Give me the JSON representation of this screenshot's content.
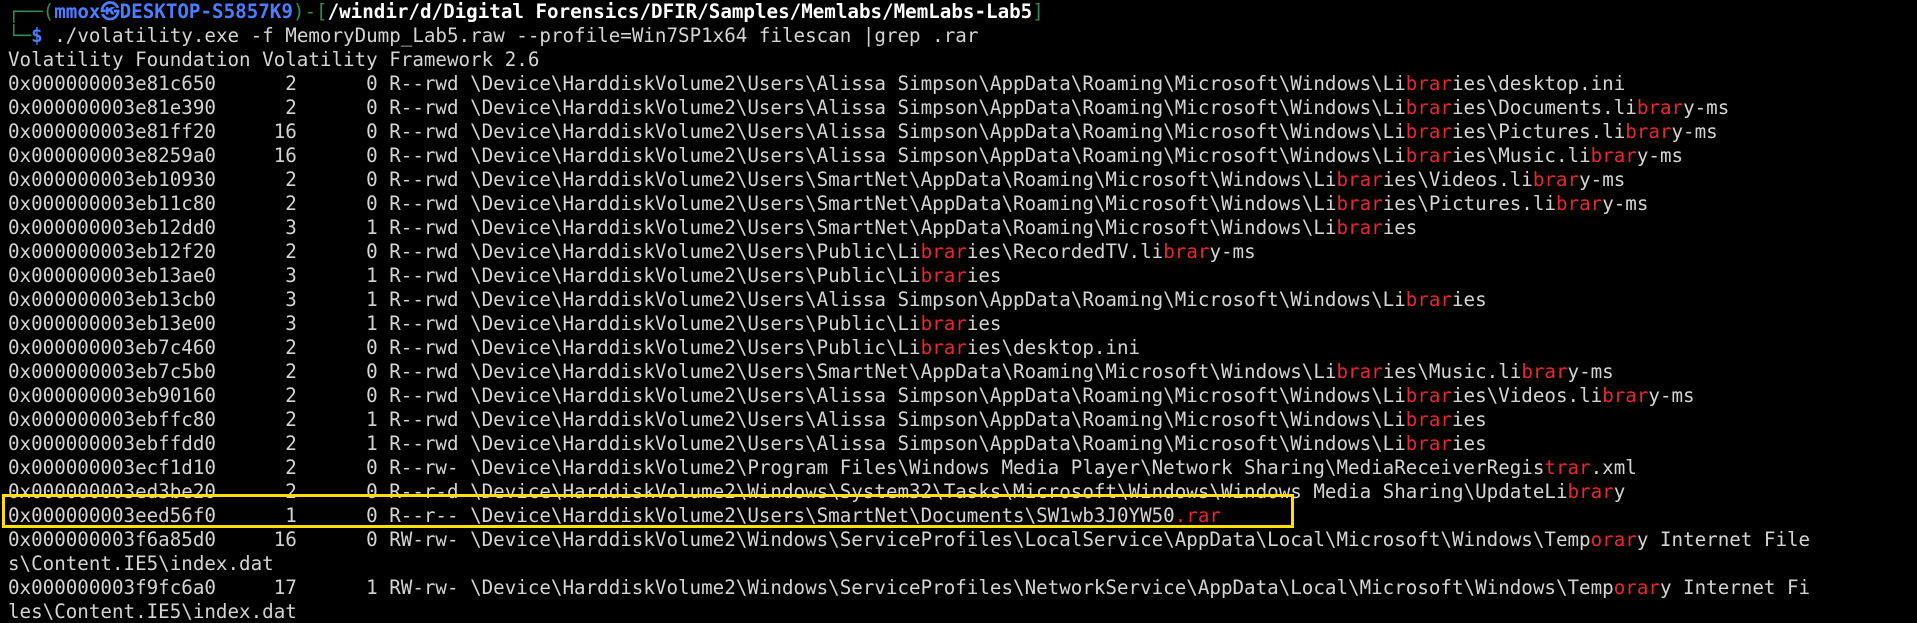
{
  "prompt": {
    "top_left": "┌──(",
    "user": "mmox",
    "at": "㉿",
    "host": "DESKTOP-S5857K9",
    "sep": ")-[",
    "path": "/windir/d/Digital Forensics/DFIR/Samples/Memlabs/MemLabs-Lab5",
    "close": "]",
    "bottom_left": "└─",
    "dollar": "$",
    "command": " ./volatility.exe -f MemoryDump_Lab5.raw --profile=Win7SP1x64 filescan |grep .rar"
  },
  "banner": "Volatility Foundation Volatility Framework 2.6",
  "colors": {
    "match": "#e8262f",
    "highlight_border": "#ffe000",
    "prompt_accent": "#4a7dff",
    "background": "#000000"
  },
  "lines": [
    {
      "pre": "0x000000003e81c650      2      0 R--rwd \\Device\\HarddiskVolume2\\Users\\Alissa Simpson\\AppData\\Roaming\\Microsoft\\Windows\\Li",
      "m1": "brar",
      "mid": "ies\\desktop.ini",
      "m2": "",
      "post": ""
    },
    {
      "pre": "0x000000003e81e390      2      0 R--rwd \\Device\\HarddiskVolume2\\Users\\Alissa Simpson\\AppData\\Roaming\\Microsoft\\Windows\\Li",
      "m1": "brar",
      "mid": "ies\\Documents.li",
      "m2": "brar",
      "post": "y-ms"
    },
    {
      "pre": "0x000000003e81ff20     16      0 R--rwd \\Device\\HarddiskVolume2\\Users\\Alissa Simpson\\AppData\\Roaming\\Microsoft\\Windows\\Li",
      "m1": "brar",
      "mid": "ies\\Pictures.li",
      "m2": "brar",
      "post": "y-ms"
    },
    {
      "pre": "0x000000003e8259a0     16      0 R--rwd \\Device\\HarddiskVolume2\\Users\\Alissa Simpson\\AppData\\Roaming\\Microsoft\\Windows\\Li",
      "m1": "brar",
      "mid": "ies\\Music.li",
      "m2": "brar",
      "post": "y-ms"
    },
    {
      "pre": "0x000000003eb10930      2      0 R--rwd \\Device\\HarddiskVolume2\\Users\\SmartNet\\AppData\\Roaming\\Microsoft\\Windows\\Li",
      "m1": "brar",
      "mid": "ies\\Videos.li",
      "m2": "brar",
      "post": "y-ms"
    },
    {
      "pre": "0x000000003eb11c80      2      0 R--rwd \\Device\\HarddiskVolume2\\Users\\SmartNet\\AppData\\Roaming\\Microsoft\\Windows\\Li",
      "m1": "brar",
      "mid": "ies\\Pictures.li",
      "m2": "brar",
      "post": "y-ms"
    },
    {
      "pre": "0x000000003eb12dd0      3      1 R--rwd \\Device\\HarddiskVolume2\\Users\\SmartNet\\AppData\\Roaming\\Microsoft\\Windows\\Li",
      "m1": "brar",
      "mid": "ies",
      "m2": "",
      "post": ""
    },
    {
      "pre": "0x000000003eb12f20      2      0 R--rwd \\Device\\HarddiskVolume2\\Users\\Public\\Li",
      "m1": "brar",
      "mid": "ies\\RecordedTV.li",
      "m2": "brar",
      "post": "y-ms"
    },
    {
      "pre": "0x000000003eb13ae0      3      1 R--rwd \\Device\\HarddiskVolume2\\Users\\Public\\Li",
      "m1": "brar",
      "mid": "ies",
      "m2": "",
      "post": ""
    },
    {
      "pre": "0x000000003eb13cb0      3      1 R--rwd \\Device\\HarddiskVolume2\\Users\\Alissa Simpson\\AppData\\Roaming\\Microsoft\\Windows\\Li",
      "m1": "brar",
      "mid": "ies",
      "m2": "",
      "post": ""
    },
    {
      "pre": "0x000000003eb13e00      3      1 R--rwd \\Device\\HarddiskVolume2\\Users\\Public\\Li",
      "m1": "brar",
      "mid": "ies",
      "m2": "",
      "post": ""
    },
    {
      "pre": "0x000000003eb7c460      2      0 R--rwd \\Device\\HarddiskVolume2\\Users\\Public\\Li",
      "m1": "brar",
      "mid": "ies\\desktop.ini",
      "m2": "",
      "post": ""
    },
    {
      "pre": "0x000000003eb7c5b0      2      0 R--rwd \\Device\\HarddiskVolume2\\Users\\SmartNet\\AppData\\Roaming\\Microsoft\\Windows\\Li",
      "m1": "brar",
      "mid": "ies\\Music.li",
      "m2": "brar",
      "post": "y-ms"
    },
    {
      "pre": "0x000000003eb90160      2      0 R--rwd \\Device\\HarddiskVolume2\\Users\\Alissa Simpson\\AppData\\Roaming\\Microsoft\\Windows\\Li",
      "m1": "brar",
      "mid": "ies\\Videos.li",
      "m2": "brar",
      "post": "y-ms"
    },
    {
      "pre": "0x000000003ebffc80      2      1 R--rwd \\Device\\HarddiskVolume2\\Users\\Alissa Simpson\\AppData\\Roaming\\Microsoft\\Windows\\Li",
      "m1": "brar",
      "mid": "ies",
      "m2": "",
      "post": ""
    },
    {
      "pre": "0x000000003ebffdd0      2      1 R--rwd \\Device\\HarddiskVolume2\\Users\\Alissa Simpson\\AppData\\Roaming\\Microsoft\\Windows\\Li",
      "m1": "brar",
      "mid": "ies",
      "m2": "",
      "post": ""
    },
    {
      "pre": "0x000000003ecf1d10      2      0 R--rw- \\Device\\HarddiskVolume2\\Program Files\\Windows Media Player\\Network Sharing\\MediaReceiverRegis",
      "m1": "trar",
      "mid": ".xml",
      "m2": "",
      "post": ""
    },
    {
      "pre": "0x000000003ed3be20      2      0 R--r-d \\Device\\HarddiskVolume2\\Windows\\System32\\Tasks\\Microsoft\\Windows\\Windows Media Sharing\\UpdateLi",
      "m1": "brar",
      "mid": "y",
      "m2": "",
      "post": ""
    },
    {
      "pre": "0x000000003eed56f0      1      0 R--r-- \\Device\\HarddiskVolume2\\Users\\SmartNet\\Documents\\SW1wb3J0YW50",
      "m1": ".rar",
      "mid": "",
      "m2": "",
      "post": ""
    },
    {
      "pre": "0x000000003f6a85d0     16      0 RW-rw- \\Device\\HarddiskVolume2\\Windows\\ServiceProfiles\\LocalService\\AppData\\Local\\Microsoft\\Windows\\Temp",
      "m1": "orar",
      "mid": "y Internet File",
      "m2": "",
      "post": ""
    },
    {
      "pre": "s\\Content.IE5\\index.dat",
      "m1": "",
      "mid": "",
      "m2": "",
      "post": ""
    },
    {
      "pre": "0x000000003f9fc6a0     17      1 RW-rw- \\Device\\HarddiskVolume2\\Windows\\ServiceProfiles\\NetworkService\\AppData\\Local\\Microsoft\\Windows\\Temp",
      "m1": "orar",
      "mid": "y Internet Fi",
      "m2": "",
      "post": ""
    },
    {
      "pre": "les\\Content.IE5\\index.dat",
      "m1": "",
      "mid": "",
      "m2": "",
      "post": ""
    }
  ]
}
